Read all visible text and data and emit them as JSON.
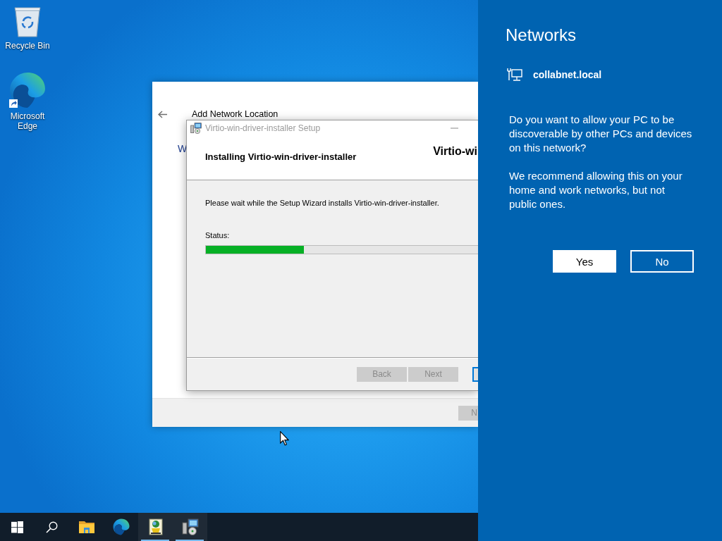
{
  "desktop": {
    "icons": [
      {
        "label": "Recycle Bin",
        "kind": "recycle-bin"
      },
      {
        "label": "Microsoft Edge",
        "kind": "edge"
      }
    ]
  },
  "back_window": {
    "title": "Add Network Location",
    "heading": "W",
    "footer_button": {
      "label": "N",
      "disabled": true
    }
  },
  "setup_window": {
    "title": "Virtio-win-driver-installer Setup",
    "active": false,
    "header_title": "Installing Virtio-win-driver-installer",
    "brand": "Virtio-wi",
    "message": "Please wait while the Setup Wizard installs Virtio-win-driver-installer.",
    "status_label": "Status:",
    "progress": {
      "level": 0.36
    },
    "buttons": [
      {
        "label": "Back",
        "disabled": true
      },
      {
        "label": "Next",
        "disabled": true
      }
    ],
    "partial_button": {
      "focused": true
    }
  },
  "taskbar": {
    "items": [
      {
        "kind": "start",
        "running": false
      },
      {
        "kind": "search",
        "running": false
      },
      {
        "kind": "explorer",
        "running": false
      },
      {
        "kind": "edge",
        "running": false
      },
      {
        "kind": "app",
        "running": true
      },
      {
        "kind": "setup",
        "running": true
      }
    ]
  },
  "network_panel": {
    "title": "Networks",
    "network": "collabnet.local",
    "question": "Do you want to allow your PC to be discoverable by other PCs and devices on this network?",
    "recommendation": "We recommend allowing this on your home and work networks, but not public ones.",
    "buttons": [
      {
        "label": "Yes",
        "kind": "primary"
      },
      {
        "label": "No",
        "kind": "secondary"
      }
    ]
  }
}
